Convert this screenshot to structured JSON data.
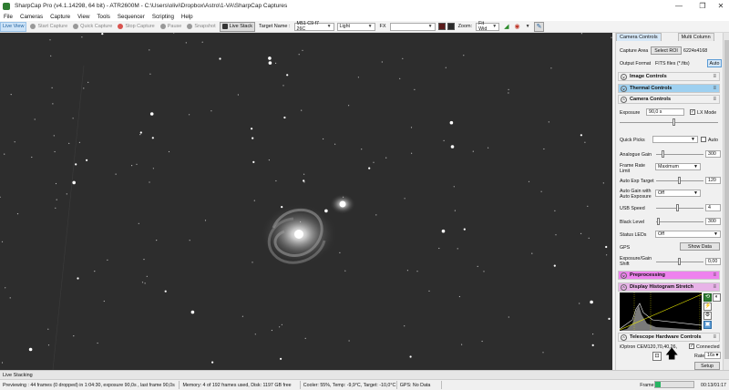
{
  "title_bar": {
    "title": "SharpCap Pro (v4.1.14298, 64 bit) - ATR2600M - C:\\Users\\olivi\\Dropbox\\Astro\\1-VA\\SharpCap Captures",
    "minimize": "—",
    "maximize": "❐",
    "close": "✕"
  },
  "menu": [
    "File",
    "Cameras",
    "Capture",
    "View",
    "Tools",
    "Sequencer",
    "Scripting",
    "Help"
  ],
  "toolbar": {
    "live_view": "Live View",
    "start_capture": "Start Capture",
    "quick_capture": "Quick Capture",
    "stop_capture": "Stop Capture",
    "pause": "Pause",
    "snapshot": "Snapshot",
    "live_stack": "Live Stack",
    "target_name_label": "Target Name :",
    "target_name_value": "M51 C9 f7 26C",
    "frame_type_value": "Light",
    "fx_label": "FX",
    "fx_value": "",
    "zoom_label": "Zoom:",
    "zoom_value": "Fit Wid"
  },
  "panel": {
    "tabs": [
      "Camera Controls",
      "Multi Column"
    ],
    "capture_area_label": "Capture Area",
    "select_roi": "Select ROI",
    "capture_area_value": "6224x4168",
    "output_format_label": "Output Format",
    "output_format_value": "FITS files (*.fits)",
    "auto": "Auto",
    "sections": {
      "image_controls": "Image Controls",
      "thermal_controls": "Thermal Controls",
      "camera_controls": "Camera Controls",
      "preprocessing": "Preprocessing",
      "display_histogram": "Display Histogram Stretch",
      "telescope": "Telescope Hardware Controls"
    },
    "exposure_label": "Exposure",
    "exposure_value": "90,0 s",
    "lx_mode": "LX Mode",
    "quick_picks_label": "Quick Picks",
    "quick_picks_auto": "Auto",
    "analogue_gain_label": "Analogue Gain",
    "analogue_gain_value": "300",
    "frame_rate_label": "Frame Rate Limit",
    "frame_rate_value": "Maximum",
    "auto_exp_target_label": "Auto Exp Target",
    "auto_exp_target_value": "120",
    "auto_gain_label": "Auto Gain with Auto Exposure",
    "auto_gain_value": "Off",
    "usb_speed_label": "USB Speed",
    "usb_speed_value": "4",
    "black_level_label": "Black Level",
    "black_level_value": "300",
    "status_leds_label": "Status LEDs",
    "status_leds_value": "Off",
    "gps_label": "GPS",
    "show_data": "Show Data",
    "exposure_gain_shift_label": "Exposure/Gain Shift",
    "exposure_gain_shift_value": "0,00",
    "mount_name": "iOptron CEM120,70,40,26,",
    "connected": "Connected",
    "rate_label": "Rate:",
    "rate_value": "16x",
    "setup": "Setup"
  },
  "stack_tab": "Live Stacking",
  "status": {
    "previewing": "Previewing : 44 frames (0 dropped) in 1:04:30, exposure 90,0s , last frame 90,0s",
    "memory": "Memory: 4 of 192 frames used, Disk: 1197 GB free",
    "cooler": "Cooler: 55%, Temp: -9,9°C, Target: -10,0°C",
    "gps": "GPS: No Data",
    "frame_label": "Frame:",
    "elapsed": "00:13/01:17",
    "progress": 0.15
  },
  "colors": {
    "thermal_header": "#9ed0f0",
    "preprocessing_header": "#ee82ee",
    "histogram_header": "#e8b3e8",
    "progress_fill": "#28b463"
  }
}
